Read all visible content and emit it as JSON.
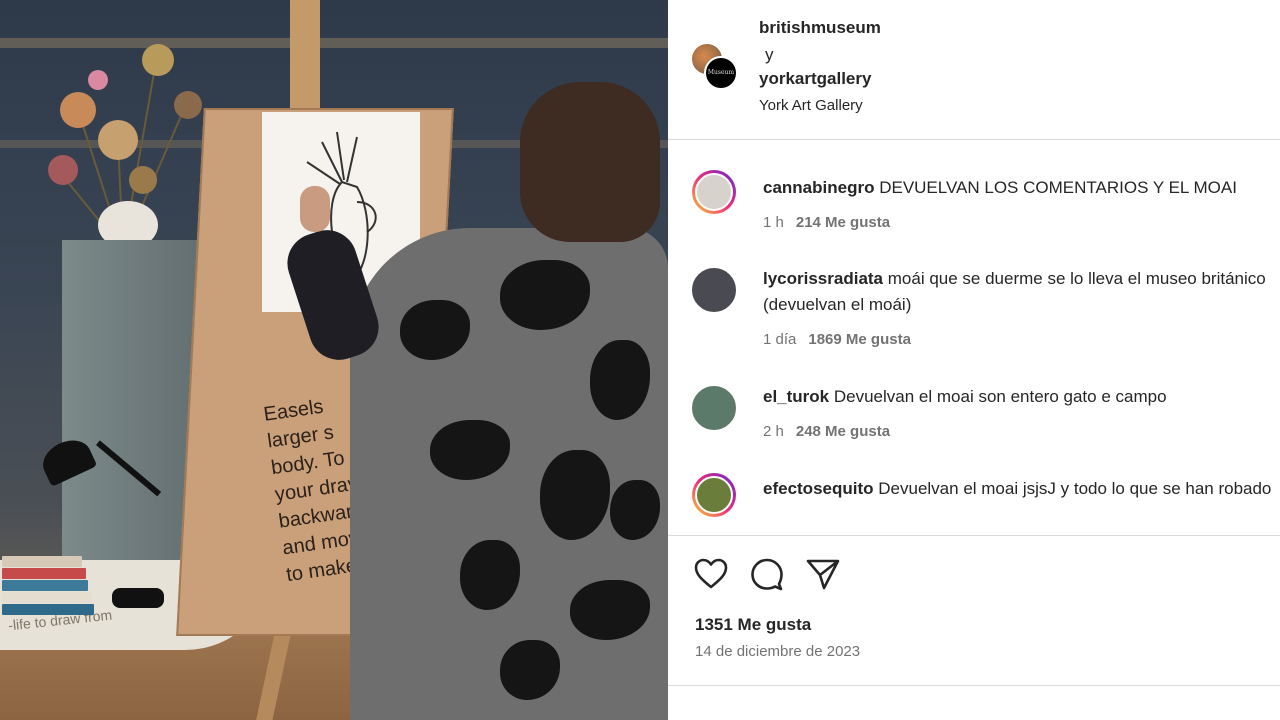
{
  "post": {
    "media_alt": "woman drawing on an easel in a gallery",
    "board_text_lines": [
      "Easels",
      "larger s",
      "body. To",
      "your drav",
      "backwards",
      "and move it f",
      "to make your m"
    ],
    "table_text": "-life to draw from"
  },
  "header": {
    "user1": "britishmuseum",
    "and": "y",
    "user2": "yorkartgallery",
    "location": "York Art Gallery"
  },
  "comments": [
    {
      "username": "cannabinegro",
      "text": "DEVUELVAN LOS COMENTARIOS Y EL MOAI",
      "time": "1 h",
      "likes": "214 Me gusta",
      "story": true,
      "avatar_color": "#d7d2cc"
    },
    {
      "username": "lycorissradiata",
      "text": "moái que se duerme se lo lleva el museo británico (devuelvan el moái)",
      "time": "1 día",
      "likes": "1869 Me gusta",
      "story": false,
      "avatar_color": "#4a4a52"
    },
    {
      "username": "el_turok",
      "text": "Devuelvan el moai son entero gato e campo",
      "time": "2 h",
      "likes": "248 Me gusta",
      "story": false,
      "avatar_color": "#5c7a6a"
    },
    {
      "username": "efectosequito",
      "text": "Devuelvan el moai jsjsJ y todo lo que se han robado",
      "time": "",
      "likes": "",
      "story": true,
      "avatar_color": "#6a7d3a"
    }
  ],
  "actions": {
    "like_icon": "heart-icon",
    "comment_icon": "comment-icon",
    "share_icon": "send-icon"
  },
  "summary": {
    "likes_total": "1351 Me gusta",
    "date": "14 de diciembre de 2023"
  }
}
